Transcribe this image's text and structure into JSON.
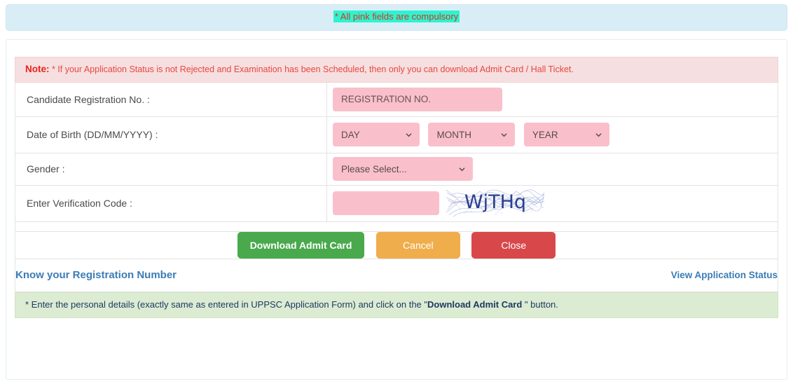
{
  "banner": {
    "text": "* All pink fields are compulsory",
    "highlight_color": "#2ff3d0",
    "text_color": "#d9321f"
  },
  "note": {
    "label": "Note:",
    "text": " * If your Application Status is not Rejected and Examination has been Scheduled, then only you can download Admit Card / Hall Ticket."
  },
  "form": {
    "registration": {
      "label": "Candidate Registration No. :",
      "placeholder": "REGISTRATION NO.",
      "value": ""
    },
    "dob": {
      "label": "Date of Birth (DD/MM/YYYY) :",
      "day": "DAY",
      "month": "MONTH",
      "year": "YEAR"
    },
    "gender": {
      "label": "Gender :",
      "selected": "Please Select..."
    },
    "verification": {
      "label": "Enter Verification Code :",
      "placeholder": "",
      "value": "",
      "captcha_text": "WjTHq",
      "captcha_color": "#2b3f8c"
    }
  },
  "buttons": {
    "download": "Download Admit Card",
    "cancel": "Cancel",
    "close": "Close",
    "download_color": "#49a94c",
    "cancel_color": "#efad4b",
    "close_color": "#d8484a"
  },
  "links": {
    "know_registration": "Know your Registration Number",
    "view_status": "View Application Status",
    "link_color": "#3b7cb5"
  },
  "footer": {
    "prefix": "* Enter the personal details (exactly same as entered in UPPSC Application Form) and click on the \"",
    "bold": "Download Admit Card ",
    "suffix": "\" button."
  }
}
